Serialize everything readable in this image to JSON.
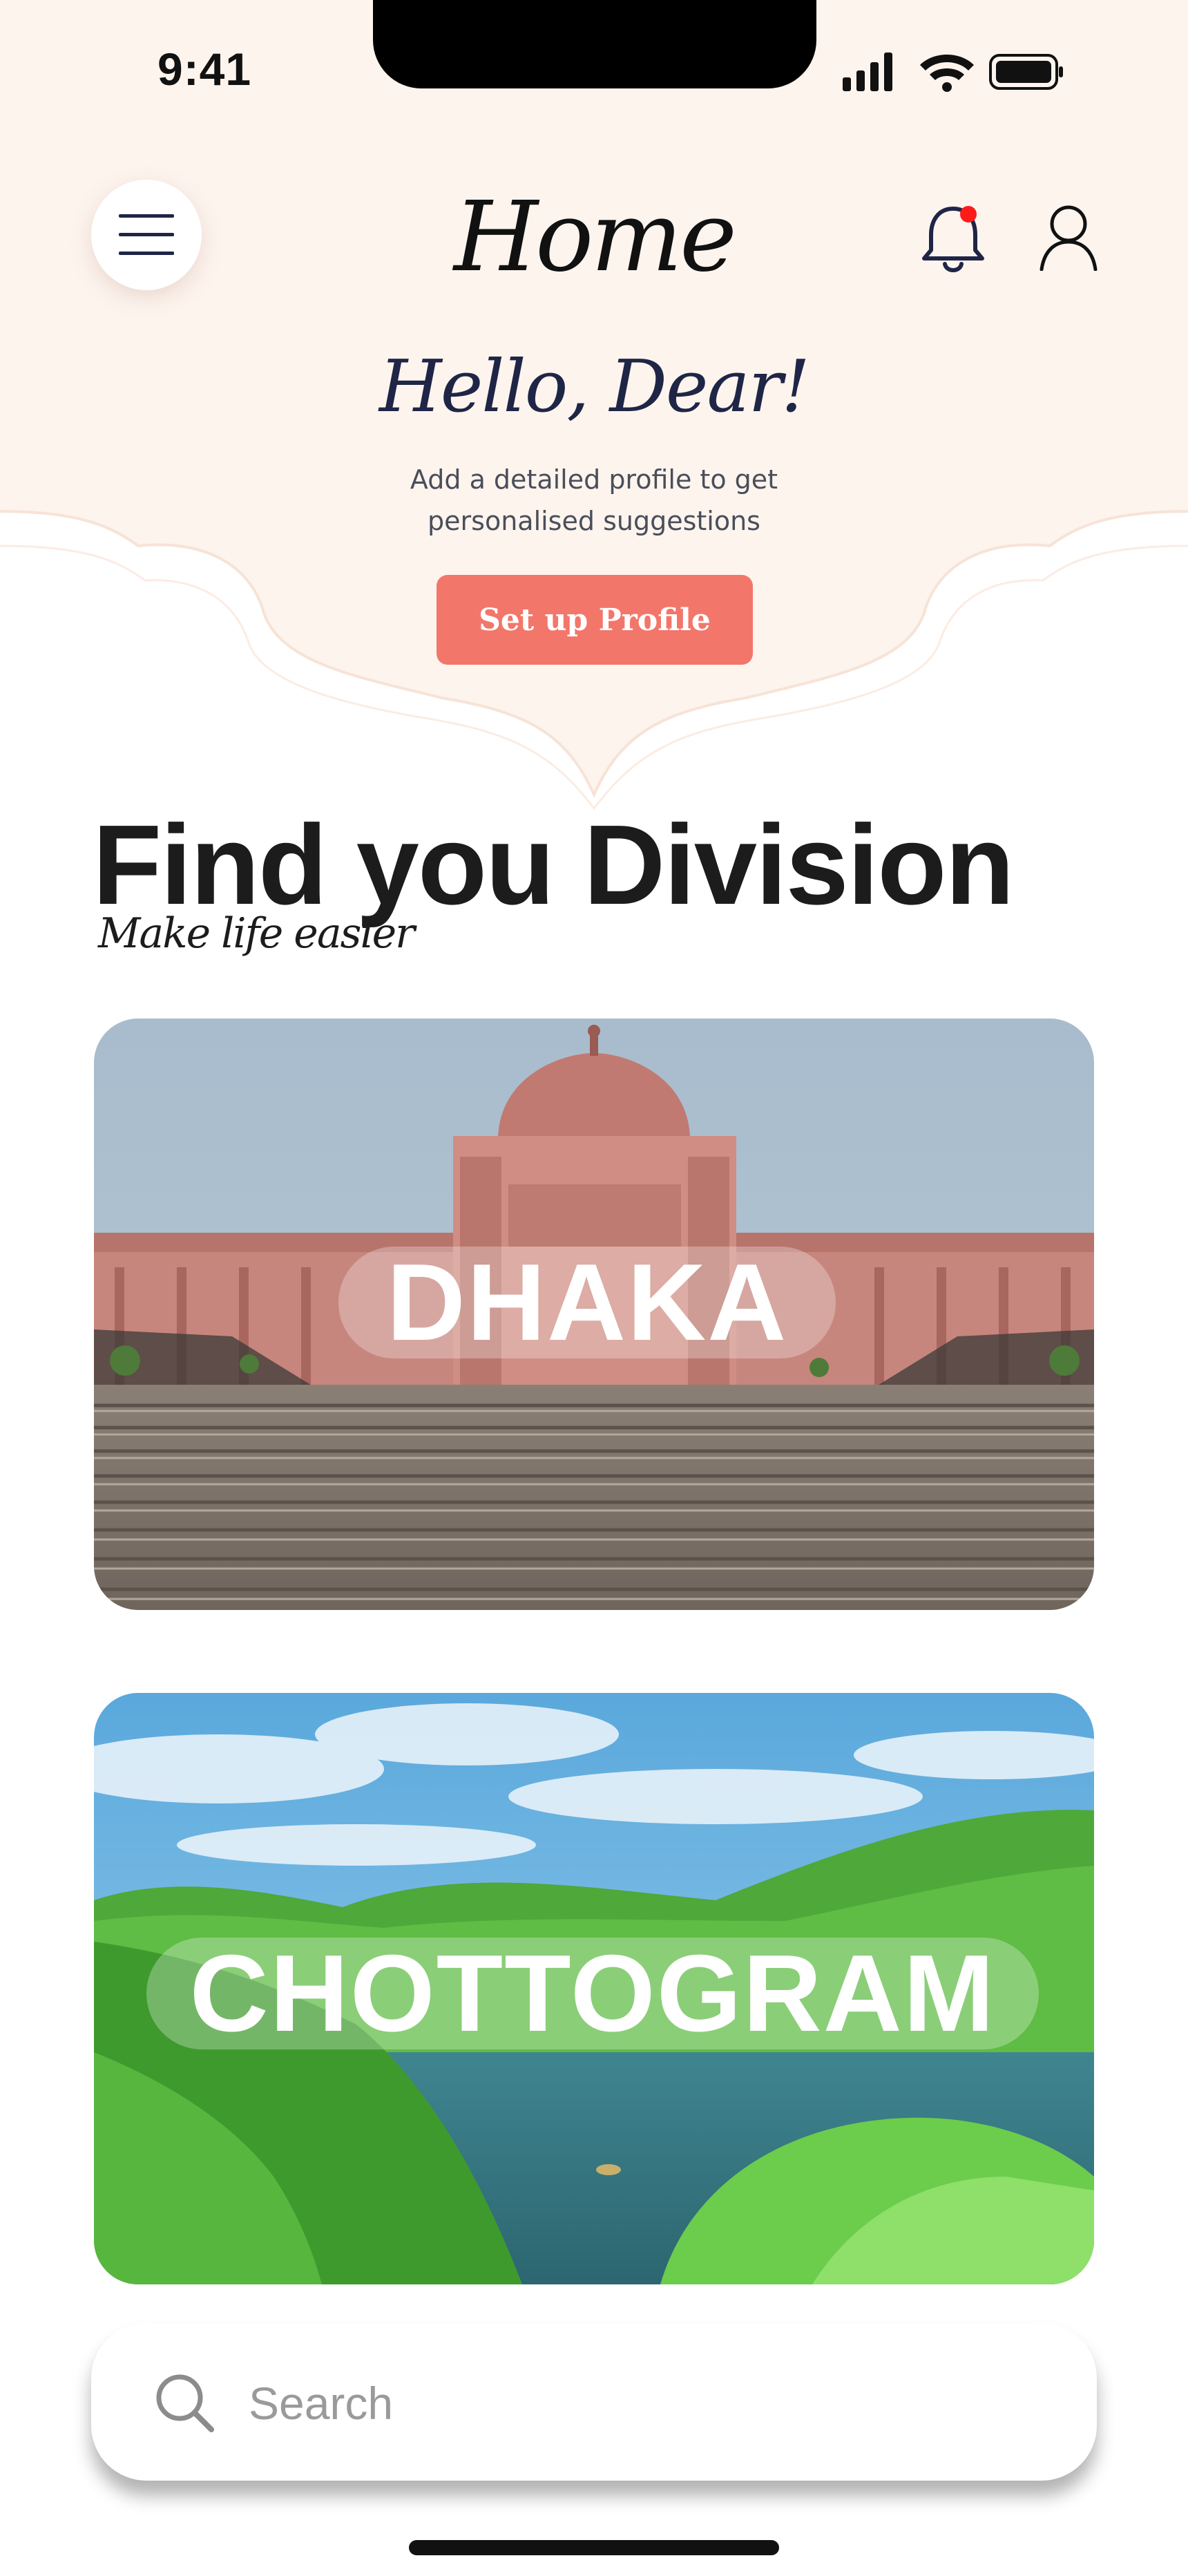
{
  "status_bar": {
    "time": "9:41"
  },
  "header": {
    "title": "Home",
    "greeting": "Hello, Dear!",
    "subtext_line1": "Add a detailed profile to get",
    "subtext_line2": "personalised suggestions",
    "setup_button": "Set up Profile",
    "notification_dot_color": "#ff1a1a"
  },
  "section": {
    "title": "Find you Division",
    "subtitle": "Make life easier"
  },
  "cards": [
    {
      "name": "DHAKA"
    },
    {
      "name": "CHOTTOGRAM"
    }
  ],
  "search": {
    "placeholder": "Search"
  },
  "colors": {
    "header_bg": "#fdf4ee",
    "accent": "#f3766b",
    "greeting": "#1f2546"
  }
}
